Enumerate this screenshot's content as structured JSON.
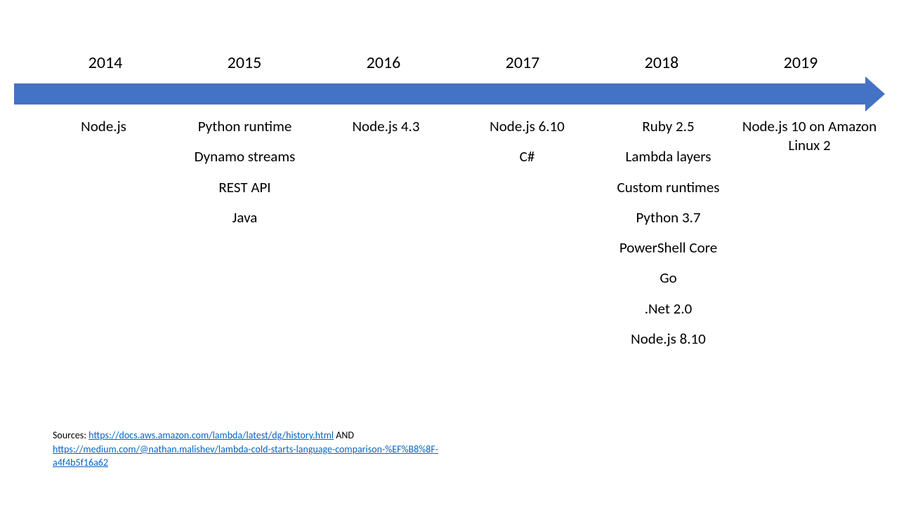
{
  "timeline": {
    "years": [
      "2014",
      "2015",
      "2016",
      "2017",
      "2018",
      "2019"
    ],
    "columns": [
      {
        "items": [
          "Node.js"
        ]
      },
      {
        "items": [
          "Python runtime",
          "Dynamo streams",
          "REST API",
          "Java"
        ]
      },
      {
        "items": [
          "Node.js 4.3"
        ]
      },
      {
        "items": [
          "Node.js 6.10",
          "C#"
        ]
      },
      {
        "items": [
          "Ruby 2.5",
          "Lambda layers",
          "Custom runtimes",
          "Python 3.7",
          "PowerShell Core",
          "Go",
          ".Net 2.0",
          "Node.js 8.10"
        ]
      },
      {
        "items": [
          "Node.js 10 on Amazon Linux 2"
        ]
      }
    ]
  },
  "sources": {
    "label": "Sources: ",
    "link1_text": "https://docs.aws.amazon.com/lambda/latest/dg/history.html",
    "and": "  AND",
    "link2_text": "https://medium.com/@nathan.malishev/lambda-cold-starts-language-comparison-%EF%B8%8F-a4f4b5f16a62"
  }
}
